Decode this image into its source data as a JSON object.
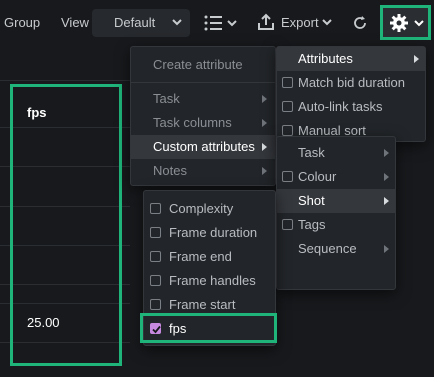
{
  "toolbar": {
    "group_label": "Group",
    "view_label": "View",
    "view_value": "Default",
    "export_label": "Export"
  },
  "grid": {
    "column_header": "fps",
    "cell_value": "25.00"
  },
  "menu_main": {
    "items": [
      {
        "label": "Create attribute"
      },
      {
        "label": "Task"
      },
      {
        "label": "Task columns"
      },
      {
        "label": "Custom attributes"
      },
      {
        "label": "Notes"
      }
    ]
  },
  "menu_right": {
    "items": [
      {
        "label": "Attributes"
      },
      {
        "label": "Match bid duration",
        "checked": false
      },
      {
        "label": "Auto-link tasks",
        "checked": false
      },
      {
        "label": "Manual sort",
        "checked": false
      }
    ]
  },
  "menu_custom": {
    "items": [
      {
        "label": "Task"
      },
      {
        "label": "Colour"
      },
      {
        "label": "Shot"
      },
      {
        "label": "Tags"
      },
      {
        "label": "Sequence"
      }
    ]
  },
  "menu_shot": {
    "items": [
      {
        "label": "Complexity",
        "checked": false
      },
      {
        "label": "Frame duration",
        "checked": false
      },
      {
        "label": "Frame end",
        "checked": false
      },
      {
        "label": "Frame handles",
        "checked": false
      },
      {
        "label": "Frame start",
        "checked": false
      },
      {
        "label": "fps",
        "checked": true
      }
    ]
  },
  "colors": {
    "highlight": "#1fb57a",
    "checkbox_on": "#c88ae0",
    "background": "#17191c",
    "menu_bg": "#222529"
  }
}
